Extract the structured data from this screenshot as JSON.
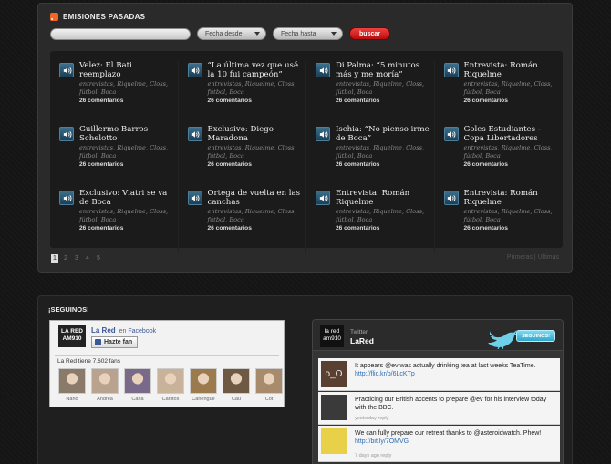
{
  "emisiones": {
    "title": "EMISIONES PASADAS",
    "search": {
      "value": "",
      "placeholder": ""
    },
    "fecha_desde": "Fecha desde",
    "fecha_hasta": "Fecha hasta",
    "buscar": "buscar",
    "items": [
      {
        "title": "Velez: El Bati reemplazo",
        "tags": "entrevistas, Riquelme, Closs, fútbol, Boca",
        "comments": "26 comentarios"
      },
      {
        "title": "“La última vez que usé la 10 fui campeón”",
        "tags": "entrevistas, Riquelme, Closs, fútbol, Boca",
        "comments": "26 comentarios"
      },
      {
        "title": "Di Palma: “5 minutos más y me moría”",
        "tags": "entrevistas, Riquelme, Closs, fútbol, Boca",
        "comments": "26 comentarios"
      },
      {
        "title": "Entrevista: Román Riquelme",
        "tags": "entrevistas, Riquelme, Closs, fútbol, Boca",
        "comments": "26 comentarios"
      },
      {
        "title": "Guillermo Barros Schelotto",
        "tags": "entrevistas, Riquelme, Closs, fútbol, Boca",
        "comments": "26 comentarios"
      },
      {
        "title": "Exclusivo: Diego Maradona",
        "tags": "entrevistas, Riquelme, Closs, fútbol, Boca",
        "comments": "26 comentarios"
      },
      {
        "title": "Ischia: “No pienso irme de Boca”",
        "tags": "entrevistas, Riquelme, Closs, fútbol, Boca",
        "comments": "26 comentarios"
      },
      {
        "title": "Goles Estudiantes - Copa Libertadores",
        "tags": "entrevistas, Riquelme, Closs, fútbol, Boca",
        "comments": "26 comentarios"
      },
      {
        "title": "Exclusivo: Viatri se va de Boca",
        "tags": "entrevistas, Riquelme, Closs, fútbol, Boca",
        "comments": "26 comentarios"
      },
      {
        "title": "Ortega de vuelta en las canchas",
        "tags": "entrevistas, Riquelme, Closs, fútbol, Boca",
        "comments": "26 comentarios"
      },
      {
        "title": "Entrevista: Román Riquelme",
        "tags": "entrevistas, Riquelme, Closs, fútbol, Boca",
        "comments": "26 comentarios"
      },
      {
        "title": "Entrevista: Román Riquelme",
        "tags": "entrevistas, Riquelme, Closs, fútbol, Boca",
        "comments": "26 comentarios"
      }
    ],
    "pages": [
      "1",
      "2",
      "3",
      "4",
      "5"
    ],
    "current_page": "1",
    "primeras": "Primeras",
    "separator": "|",
    "ultimas": "Ultimas"
  },
  "seguinos": {
    "title": "¡SEGUINOS!",
    "facebook": {
      "logo_line1": "LA RED",
      "logo_line2": "AM910",
      "page_name": "La Red",
      "on_text": "en",
      "network": "Facebook",
      "button": "Hazte fan",
      "fans_text": "La Red tiene 7.602 fans",
      "fans": [
        {
          "name": "Nano",
          "color": "#8a7a6a"
        },
        {
          "name": "Andrea",
          "color": "#b9a38e"
        },
        {
          "name": "Carla",
          "color": "#7a6a8a"
        },
        {
          "name": "Carlitos",
          "color": "#c9b29a"
        },
        {
          "name": "Canengue",
          "color": "#9b7a4e"
        },
        {
          "name": "Cau",
          "color": "#6e5a42"
        },
        {
          "name": "Cot",
          "color": "#a88a6c"
        }
      ]
    },
    "twitter": {
      "logo_line1": "la red",
      "logo_line2": "am910",
      "label": "Twitter",
      "name": "LaRed",
      "follow_button": "SEGUINOS!",
      "tweets": [
        {
          "text": "It appears @ev was actually drinking tea at last weeks TeaTime.",
          "url": "http://flic.kr/p/6LcKTp",
          "meta": "",
          "avatar_text": "o_O",
          "avatar_color": "#5a4030"
        },
        {
          "text": "Practicing our British accents to prepare @ev for his interview today with the BBC.",
          "url": "",
          "meta": "yesterday reply",
          "avatar_text": "",
          "avatar_color": "#3a3a3a"
        },
        {
          "text": "We can fully prepare our retreat thanks to @asteroidwatch. Phew!",
          "url": "http://bit.ly/7OMVG",
          "meta": "7 days ago reply",
          "avatar_text": "",
          "avatar_color": "#e8d048"
        }
      ]
    }
  }
}
